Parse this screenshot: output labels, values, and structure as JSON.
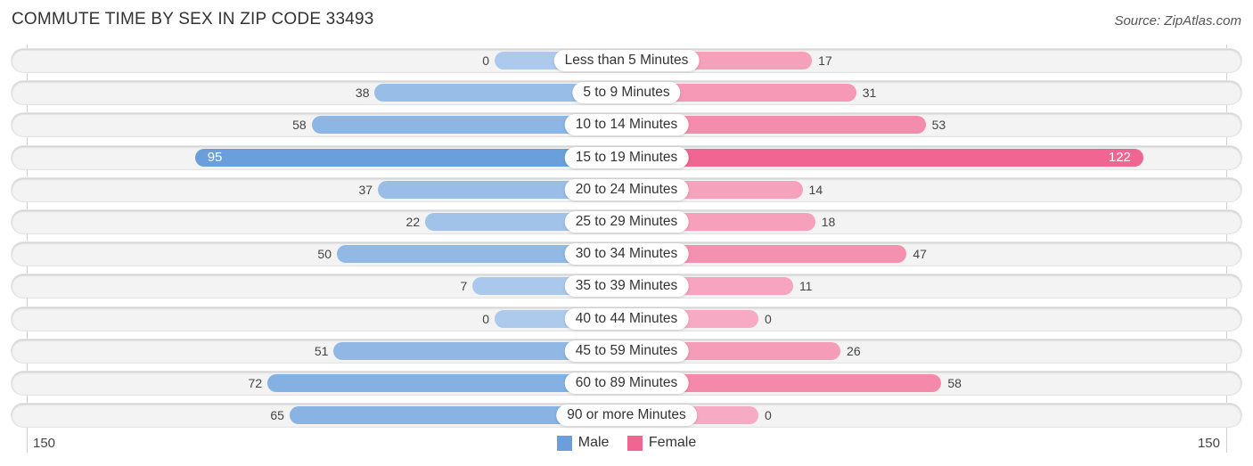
{
  "header": {
    "title": "COMMUTE TIME BY SEX IN ZIP CODE 33493",
    "source": "Source: ZipAtlas.com"
  },
  "chart_data": {
    "type": "bar",
    "orientation": "horizontal-diverging",
    "title": "COMMUTE TIME BY SEX IN ZIP CODE 33493",
    "categories": [
      "Less than 5 Minutes",
      "5 to 9 Minutes",
      "10 to 14 Minutes",
      "15 to 19 Minutes",
      "20 to 24 Minutes",
      "25 to 29 Minutes",
      "30 to 34 Minutes",
      "35 to 39 Minutes",
      "40 to 44 Minutes",
      "45 to 59 Minutes",
      "60 to 89 Minutes",
      "90 or more Minutes"
    ],
    "series": [
      {
        "name": "Male",
        "color": "#6a9fdc",
        "values": [
          0,
          38,
          58,
          95,
          37,
          22,
          50,
          7,
          0,
          51,
          72,
          65
        ]
      },
      {
        "name": "Female",
        "color": "#f06592",
        "values": [
          17,
          31,
          53,
          122,
          14,
          18,
          47,
          11,
          0,
          26,
          58,
          0
        ]
      }
    ],
    "axis": {
      "left_tick": "150",
      "right_tick": "150",
      "range": [
        0,
        150
      ]
    },
    "legend": {
      "position": "bottom-center",
      "items": [
        "Male",
        "Female"
      ]
    },
    "xlabel": "",
    "ylabel": ""
  }
}
